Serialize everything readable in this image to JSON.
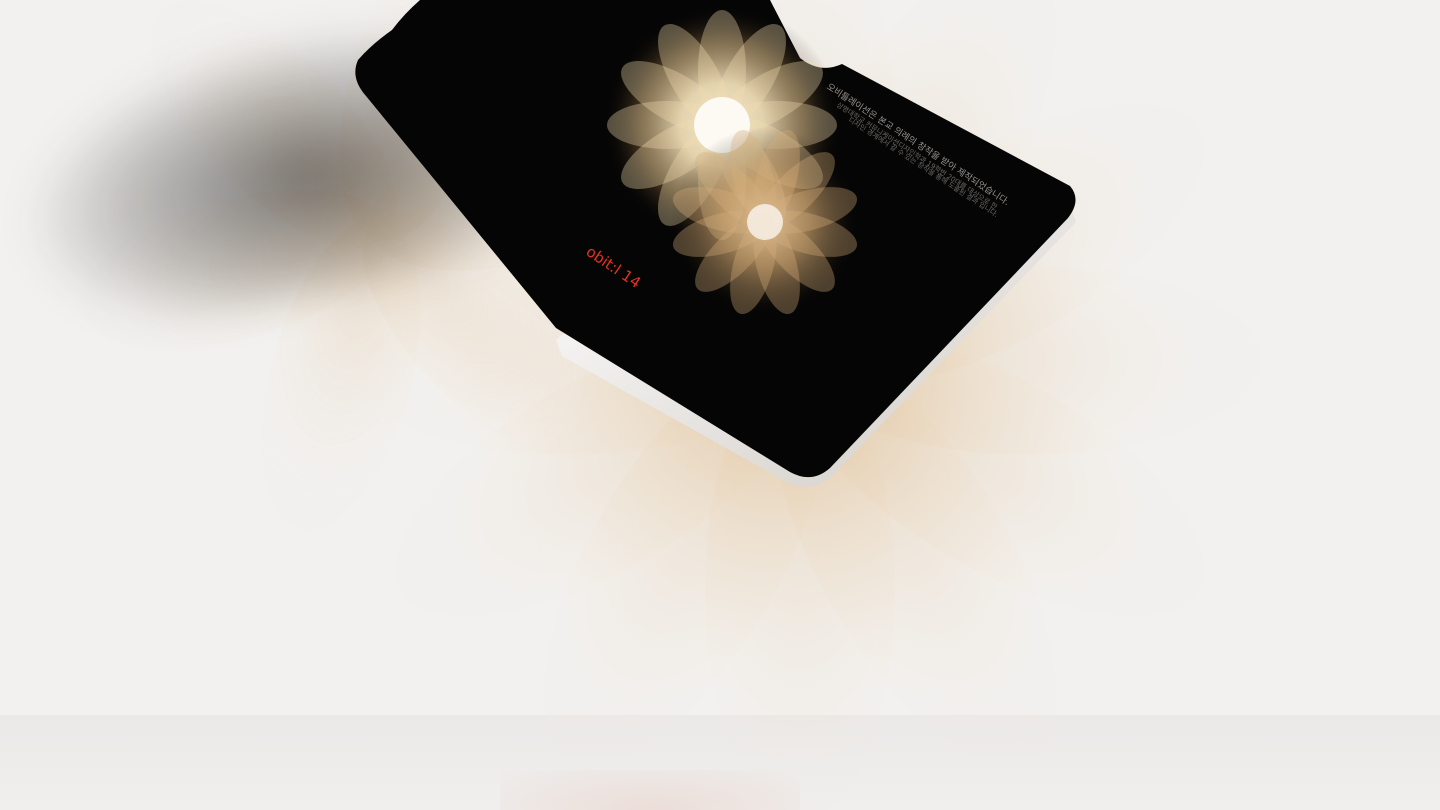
{
  "brand": {
    "logo_text": "obit:l 14",
    "logo_color": "#e8321c"
  },
  "screen_text": {
    "headline": "오비틀레이션은 본교 의례의 창작을 받아 제작되었습니다.",
    "body_line_1": "상명대학교 커뮤니케이션디자인학과 19학번 20대를 대상으로 한",
    "body_line_2": "디자인 경계에서 갈 수 있는 창작을 통해 도출된 결과 입니다."
  },
  "palette": {
    "screen": "#050505",
    "petal_warm": "#d9b98c",
    "background": "#f2f1f0"
  }
}
